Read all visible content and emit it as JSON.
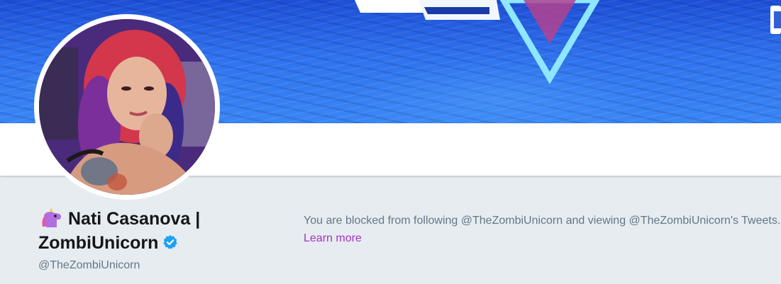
{
  "profile": {
    "name_emoji": "🦄",
    "name_line1": "Nati Casanova |",
    "name_line2": "ZombiUnicorn",
    "handle": "@TheZombiUnicorn",
    "verified": true
  },
  "blocked_notice": {
    "text": "You are blocked from following @TheZombiUnicorn and viewing @TheZombiUnicorn's Tweets.",
    "link_label": "Learn more"
  },
  "colors": {
    "page_background": "#e6ecf0",
    "link": "#a333c8",
    "verified_badge": "#1da1f2",
    "secondary_text": "#657786"
  }
}
